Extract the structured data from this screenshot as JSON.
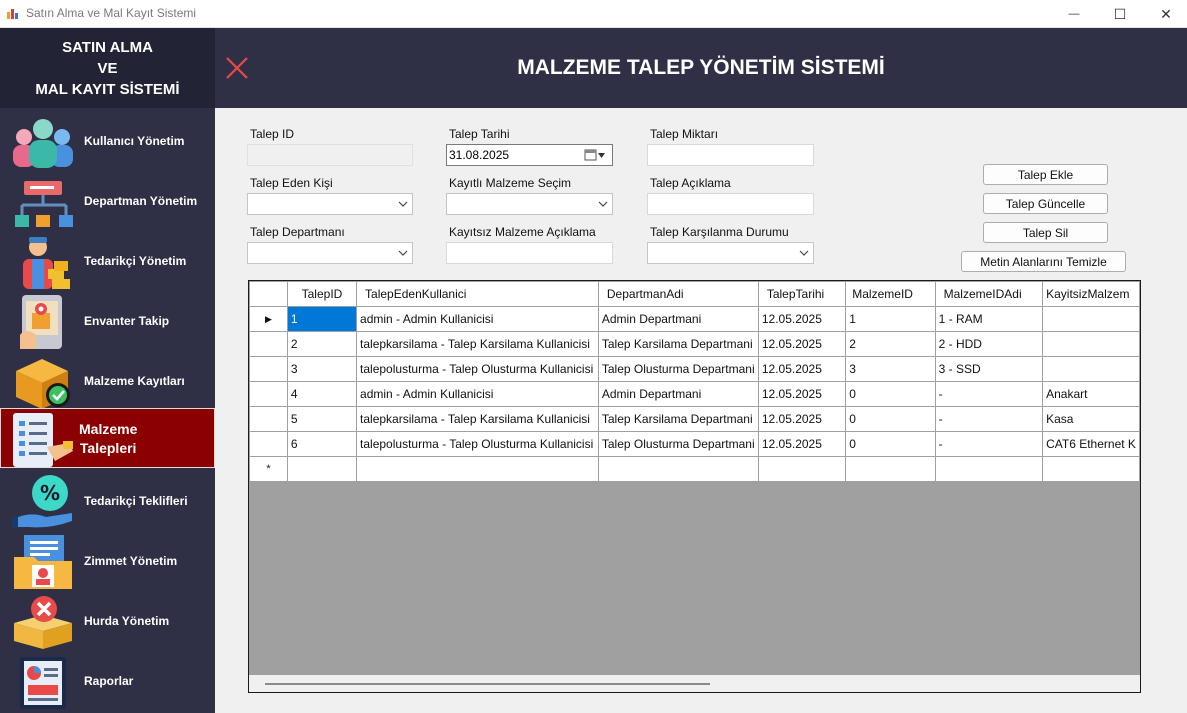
{
  "window": {
    "title": "Satın Alma ve Mal Kayıt Sistemi",
    "minimize": "—",
    "maximize": "☐",
    "close": "✕"
  },
  "brand": {
    "line1": "SATIN ALMA",
    "line2": "VE",
    "line3": "MAL KAYIT SİSTEMİ"
  },
  "header": {
    "title": "MALZEME TALEP YÖNETİM SİSTEMİ"
  },
  "nav": [
    {
      "label": "Kullanıcı Yönetim",
      "icon": "users-icon"
    },
    {
      "label": "Departman Yönetim",
      "icon": "org-chart-icon"
    },
    {
      "label": "Tedarikçi Yönetim",
      "icon": "supplier-icon"
    },
    {
      "label": "Envanter Takip",
      "icon": "inventory-map-icon"
    },
    {
      "label": "Malzeme Kayıtları",
      "icon": "box-check-icon"
    },
    {
      "label_line1": "Malzeme",
      "label_line2": "Talepleri",
      "icon": "request-list-icon",
      "active": true
    },
    {
      "label": "Tedarikçi Teklifleri",
      "icon": "discount-offer-icon"
    },
    {
      "label": "Zimmet Yönetim",
      "icon": "assignment-folder-icon"
    },
    {
      "label": "Hurda Yönetim",
      "icon": "scrap-box-icon"
    },
    {
      "label": "Raporlar",
      "icon": "report-icon"
    }
  ],
  "form": {
    "talep_id_label": "Talep ID",
    "talep_id_value": "",
    "talep_tarihi_label": "Talep Tarihi",
    "talep_tarihi_value": "31.08.2025",
    "talep_miktari_label": "Talep Miktarı",
    "talep_miktari_value": "",
    "talep_eden_label": "Talep Eden Kişi",
    "kayitli_malzeme_label": "Kayıtlı Malzeme Seçim",
    "talep_aciklama_label": "Talep Açıklama",
    "talep_aciklama_value": "",
    "talep_departman_label": "Talep Departmanı",
    "kayitsiz_malzeme_label": "Kayıtsız Malzeme Açıklama",
    "kayitsiz_malzeme_value": "",
    "karsilanma_label": "Talep Karşılanma Durumu"
  },
  "buttons": {
    "ekle": "Talep Ekle",
    "guncelle": "Talep Güncelle",
    "sil": "Talep Sil",
    "temizle": "Metin Alanlarını Temizle"
  },
  "grid": {
    "columns": [
      "TalepID",
      "TalepEdenKullanici",
      "DepartmanAdi",
      "TalepTarihi",
      "MalzemeID",
      "MalzemeIDAdi",
      "KayitsizMalzem"
    ],
    "rows": [
      [
        "1",
        "admin - Admin Kullanicisi",
        "Admin Departmani",
        "12.05.2025",
        "1",
        "1 - RAM",
        ""
      ],
      [
        "2",
        "talepkarsilama - Talep Karsilama Kullanicisi",
        "Talep Karsilama Departmani",
        "12.05.2025",
        "2",
        "2 - HDD",
        ""
      ],
      [
        "3",
        "talepolusturma - Talep Olusturma Kullanicisi",
        "Talep Olusturma Departmani",
        "12.05.2025",
        "3",
        "3 - SSD",
        ""
      ],
      [
        "4",
        "admin - Admin Kullanicisi",
        "Admin Departmani",
        "12.05.2025",
        "0",
        " -",
        "Anakart"
      ],
      [
        "5",
        "talepkarsilama - Talep Karsilama Kullanicisi",
        "Talep Karsilama Departmani",
        "12.05.2025",
        "0",
        " -",
        "Kasa"
      ],
      [
        "6",
        "talepolusturma - Talep Olusturma Kullanicisi",
        "Talep Olusturma Departmani",
        "12.05.2025",
        "0",
        " -",
        "CAT6 Ethernet K"
      ]
    ],
    "current_row_marker": "▶",
    "new_row_marker": "*"
  }
}
